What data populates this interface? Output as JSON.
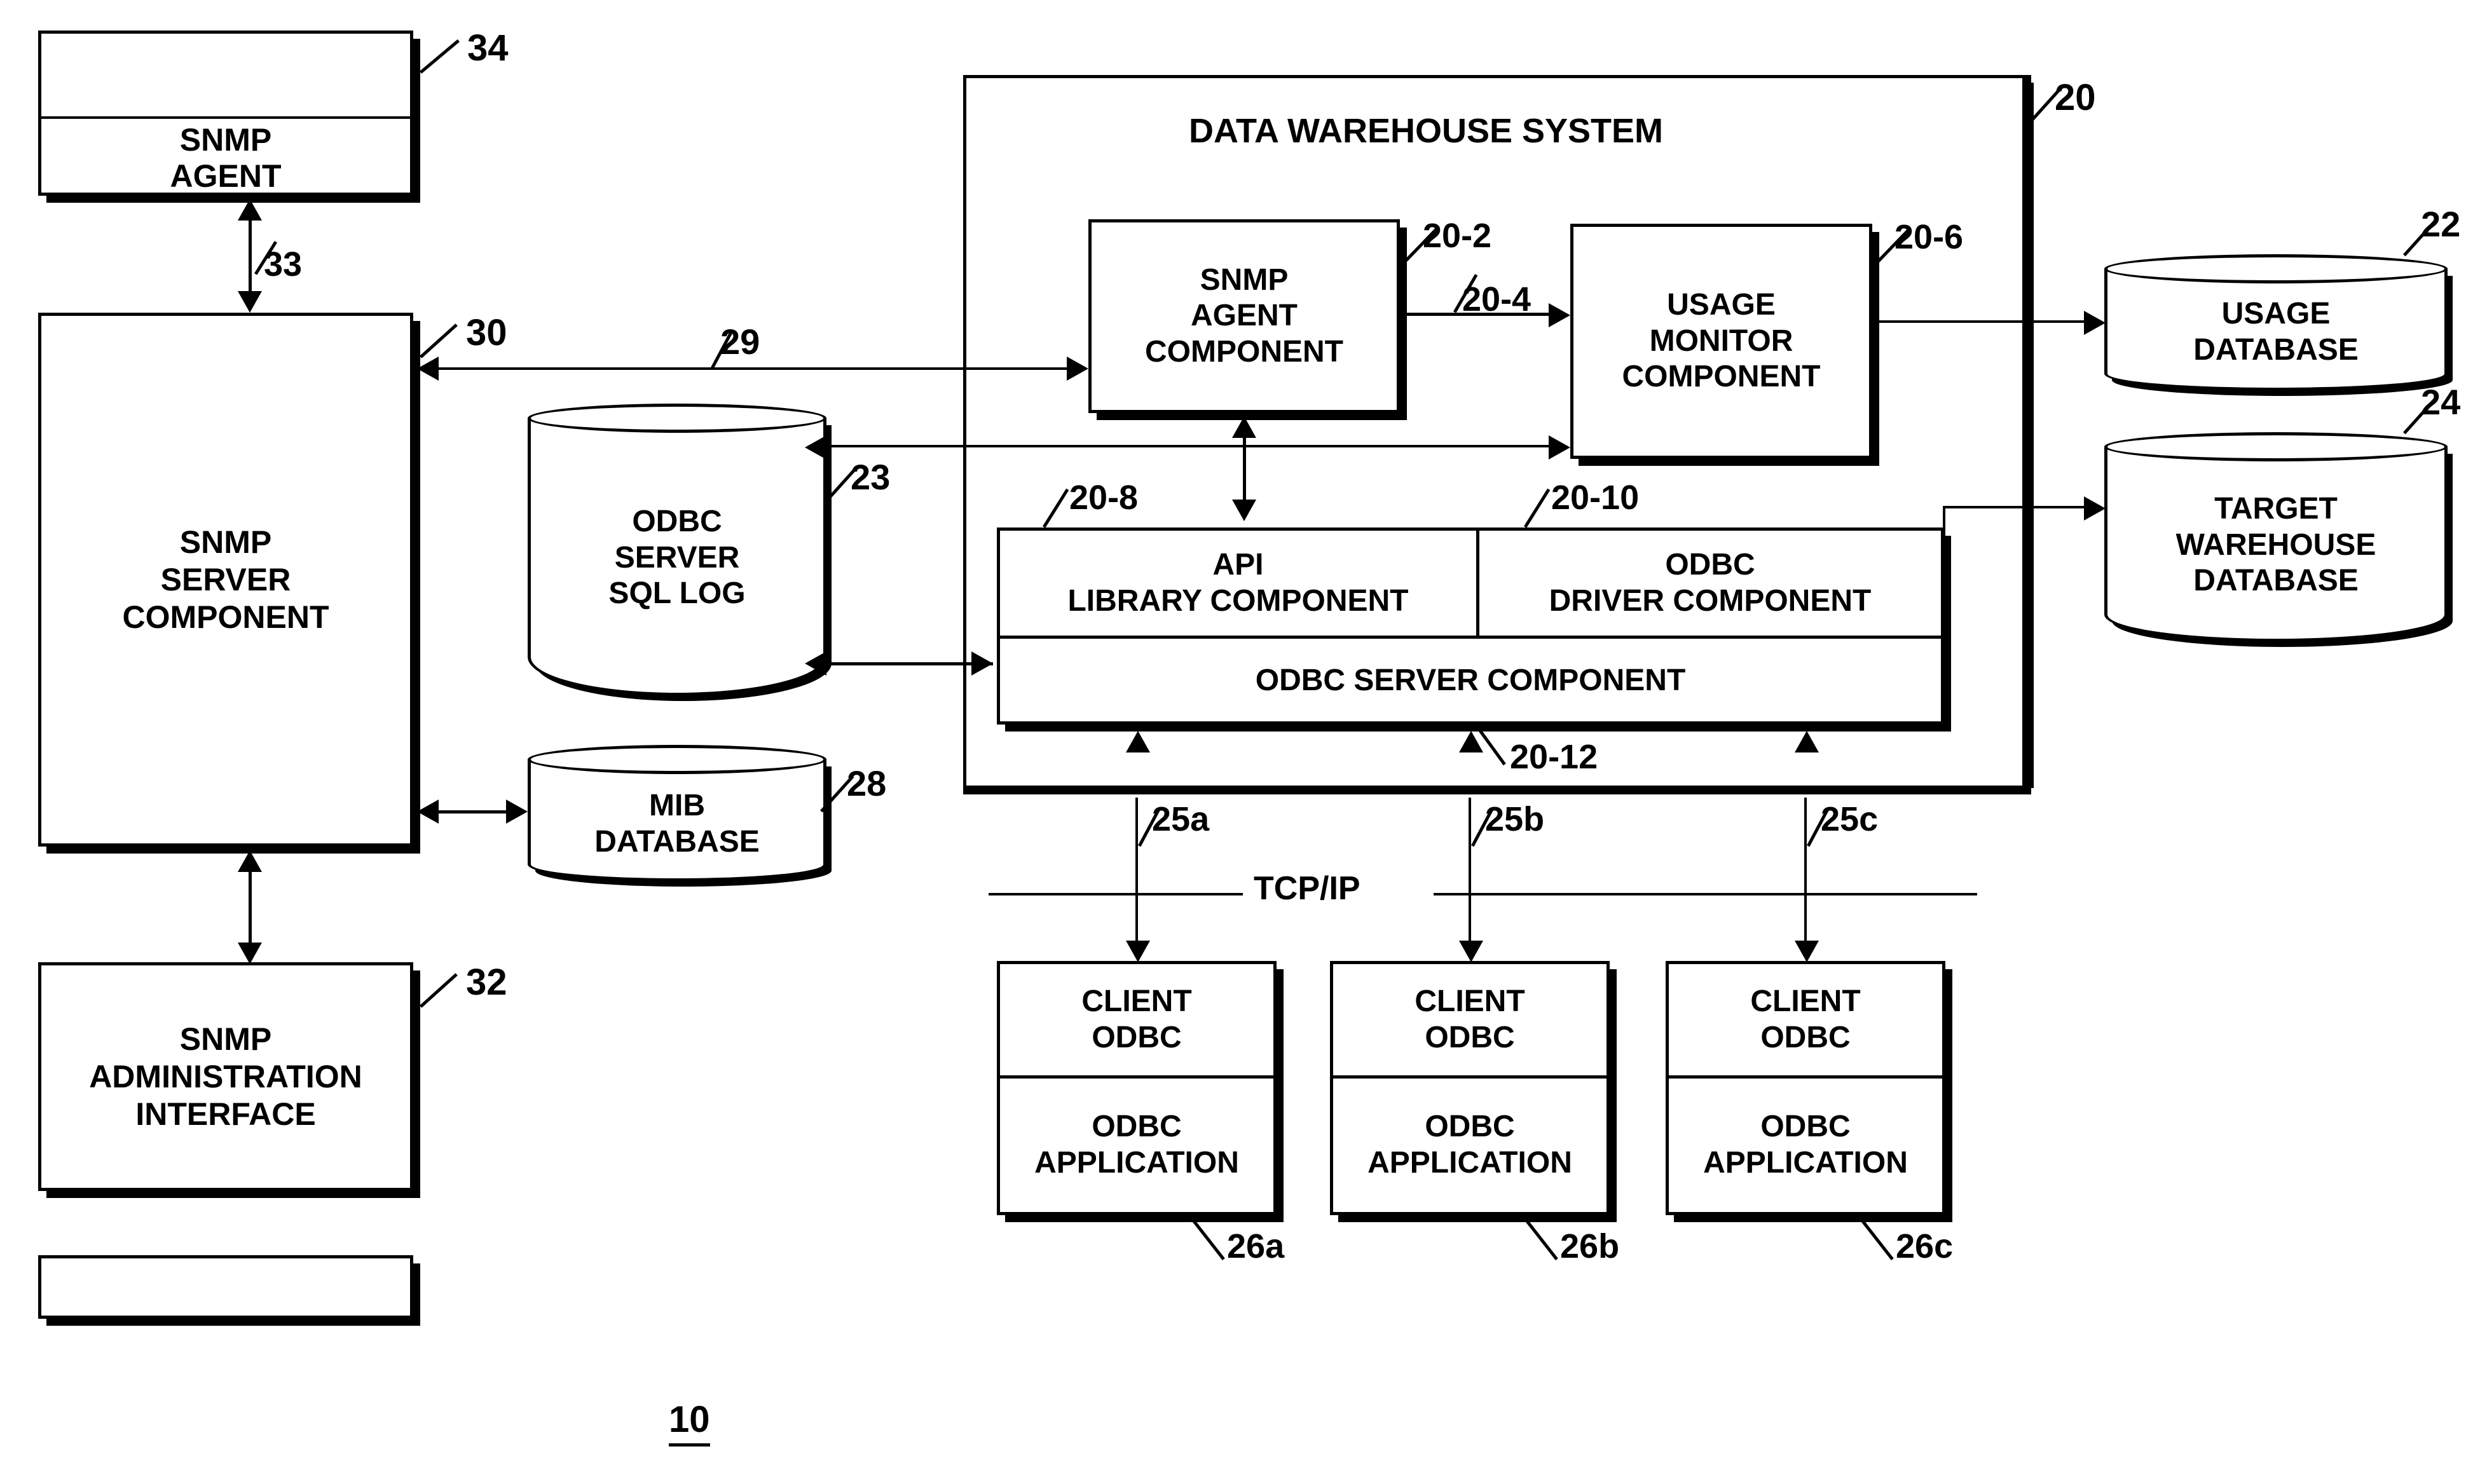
{
  "figure": {
    "number": "10"
  },
  "system": {
    "title": "DATA WAREHOUSE SYSTEM",
    "ref": "20"
  },
  "boxes": {
    "snmp_agent": {
      "line1": "SNMP",
      "line2": "AGENT",
      "ref": "34"
    },
    "snmp_server_component": {
      "line1": "SNMP",
      "line2": "SERVER",
      "line3": "COMPONENT",
      "ref": "30"
    },
    "snmp_administration_interface": {
      "line1": "SNMP",
      "line2": "ADMINISTRATION",
      "line3": "INTERFACE",
      "ref": "32"
    },
    "blank_box": {
      "ref": ""
    },
    "snmp_agent_component": {
      "line1": "SNMP",
      "line2": "AGENT",
      "line3": "COMPONENT",
      "ref": "20-2"
    },
    "usage_monitor_component": {
      "line1": "USAGE",
      "line2": "MONITOR",
      "line3": "COMPONENT",
      "ref": "20-6"
    },
    "api_library_component": {
      "line1": "API",
      "line2": "LIBRARY COMPONENT",
      "ref": "20-8"
    },
    "odbc_driver_component": {
      "line1": "ODBC",
      "line2": "DRIVER COMPONENT",
      "ref": "20-10"
    },
    "odbc_server_component": {
      "line1": "ODBC SERVER COMPONENT",
      "ref": "20-12"
    }
  },
  "databases": {
    "odbc_server_sql_log": {
      "line1": "ODBC",
      "line2": "SERVER",
      "line3": "SQL LOG",
      "ref": "23"
    },
    "mib_database": {
      "line1": "MIB",
      "line2": "DATABASE",
      "ref": "28"
    },
    "usage_database": {
      "line1": "USAGE",
      "line2": "DATABASE",
      "ref": "22"
    },
    "target_warehouse_database": {
      "line1": "TARGET",
      "line2": "WAREHOUSE",
      "line3": "DATABASE",
      "ref": "24"
    }
  },
  "clients": [
    {
      "line1": "CLIENT",
      "line2": "ODBC",
      "app1": "ODBC",
      "app2": "APPLICATION",
      "ref": "26a",
      "link_ref": "25a"
    },
    {
      "line1": "CLIENT",
      "line2": "ODBC",
      "app1": "ODBC",
      "app2": "APPLICATION",
      "ref": "26b",
      "link_ref": "25b"
    },
    {
      "line1": "CLIENT",
      "line2": "ODBC",
      "app1": "ODBC",
      "app2": "APPLICATION",
      "ref": "26c",
      "link_ref": "25c"
    }
  ],
  "network": {
    "label": "TCP/IP"
  },
  "links": {
    "snmp_agent_to_server": "33",
    "server_to_agent_component": "29",
    "agent_component_to_usage_monitor": "20-4"
  },
  "colors": {
    "line": "#000000",
    "background": "#ffffff"
  }
}
